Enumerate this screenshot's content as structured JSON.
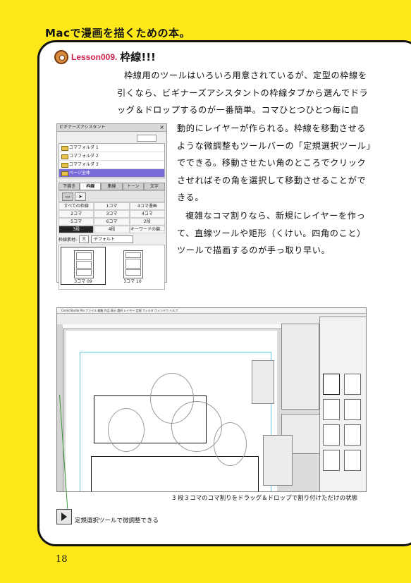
{
  "header": {
    "title": "Macで漫画を描くための本。"
  },
  "lesson": {
    "number": "Lesson009.",
    "title": "枠線!!!"
  },
  "body": {
    "p1": "枠線用のツールはいろいろ用意されているが、定型の枠線を引くなら、ビギナーズアシスタントの枠線タブから選んでドラッグ＆ドロップするのが一番簡単。コマひとつひとつ毎に自",
    "p2": "動的にレイヤーが作られる。枠線を移動させるような微調整もツールバーの「定規選択ツール」でできる。移動させたい角のところでクリックさせればその角を選択して移動させることができる。",
    "p3": "複雑なコマ割りなら、新規にレイヤーを作って、直線ツールや矩形（くけい。四角のこと）ツールで描画するのが手っ取り早い。"
  },
  "palette": {
    "title": "ビギナーズアシスタント",
    "folders": [
      "コマフォルダ 1",
      "コマフォルダ 2",
      "コマフォルダ 3",
      "ページ全体"
    ],
    "tabs": [
      "下描き",
      "枠線",
      "集線",
      "トーン",
      "文字"
    ],
    "grid": [
      [
        "すべての枠線",
        "1コマ",
        "4コマ漫画"
      ],
      [
        "2コマ",
        "3コマ",
        "4コマ"
      ],
      [
        "5コマ",
        "6コマ",
        "2段"
      ],
      [
        "3段",
        "4段",
        "キーワードの編..."
      ]
    ],
    "option_label": "枠線素材:",
    "option_size": "大",
    "option_default": "デフォルト",
    "thumbs": [
      "3コマ 09",
      "3コマ 10"
    ]
  },
  "screenshot": {
    "menu": "ComicStudio Pro  ファイル  編集  作品  表示  選択  レイヤー  定規  フィルタ  ウィンドウ  ヘルプ"
  },
  "captions": {
    "screenshot": "3 段３コマのコマ割りをドラッグ＆ドロップで割り付けただけの状態",
    "tool": "定規選択ツールで微調整できる"
  },
  "page_number": "18",
  "colors": {
    "background": "#ffe81a",
    "lesson_accent": "#d1204e",
    "selection": "#7a6cd8"
  }
}
